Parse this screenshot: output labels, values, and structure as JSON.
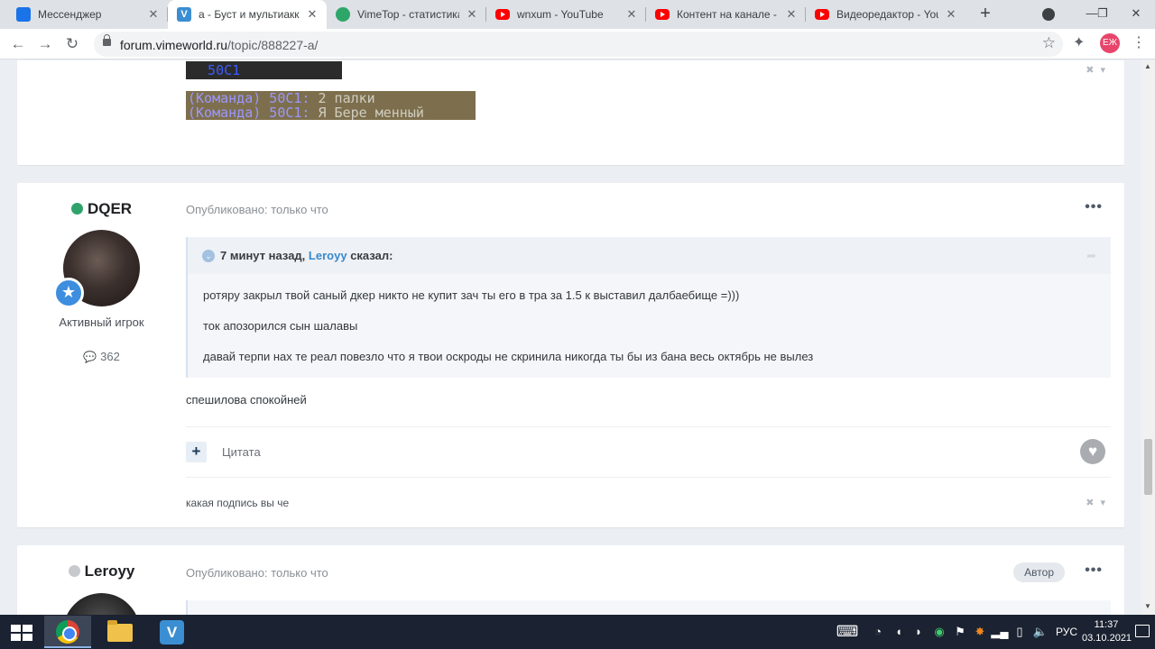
{
  "browser": {
    "tabs": [
      {
        "title": "Мессенджер",
        "icon": "messenger-icon"
      },
      {
        "title": "a - Буст и мультиаккаунт",
        "icon": "vimeworld-icon"
      },
      {
        "title": "VimeTop - статистика и",
        "icon": "vimetop-icon"
      },
      {
        "title": "wnxum - YouTube",
        "icon": "youtube-icon"
      },
      {
        "title": "Контент на канале - Yo",
        "icon": "youtube-icon"
      },
      {
        "title": "Видеоредактор - YouTu",
        "icon": "youtube-icon"
      }
    ],
    "url_host": "forum.vimeworld.ru",
    "url_path": "/topic/888227-a/",
    "profile_initials": "ЕЖ"
  },
  "prev_post": {
    "mc_line_top": "  50C1",
    "mc_team_1": "(Команда) 50C1:",
    "mc_msg_1": " 2 палки",
    "mc_team_2": "(Команда) 50C1:",
    "mc_msg_2": " Я Бере менный",
    "controls": "✖ ▾"
  },
  "post1": {
    "author": "DQER",
    "status_color": "#2fa36b",
    "group": "Активный игрок",
    "post_count": "362",
    "posted": "Опубликовано: только что",
    "quote": {
      "time": "7 минут назад,",
      "who": "Leroyy",
      "said": "сказал:",
      "lines": [
        "ротяру закрыл твой саный дкер никто не купит зач ты его в тра за 1.5 к выставил далбаебище =)))",
        "ток апозорился сын шалавы",
        "давай терпи нах те реал повезло что я твои оскроды не скринила никогда ты бы из бана весь октябрь не вылез"
      ]
    },
    "body": "спешилова спокойней",
    "quote_button": "Цитата",
    "signature": "какая подпись вы че",
    "controls": "✖ ▾"
  },
  "post2": {
    "author": "Leroyy",
    "status_color": "#c7c9cc",
    "posted": "Опубликовано: только что",
    "badge": "Автор"
  },
  "taskbar": {
    "language": "РУС",
    "time": "11:37",
    "date": "03.10.2021"
  }
}
